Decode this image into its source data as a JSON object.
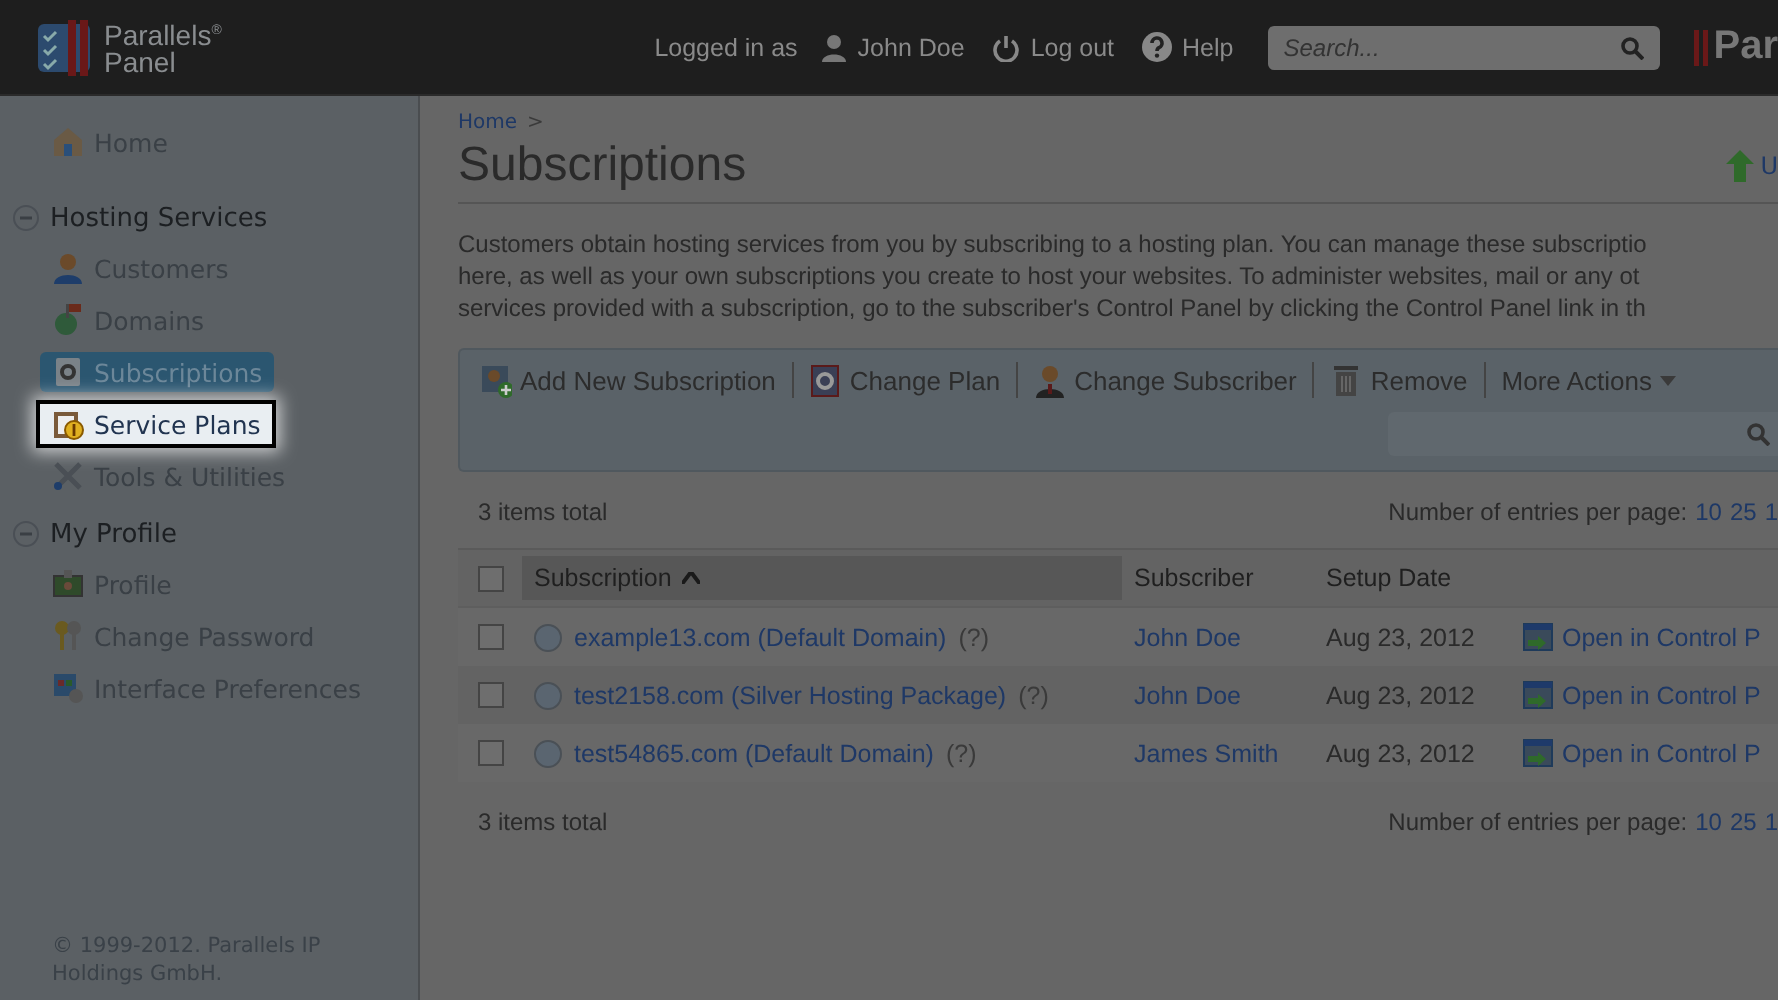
{
  "header": {
    "brand_line1": "Parallels",
    "brand_mark": "®",
    "brand_line2": "Panel",
    "logged_in_label": "Logged in as",
    "user": "John Doe",
    "logout": "Log out",
    "help": "Help",
    "search": {
      "placeholder": "Search..."
    },
    "right_logo": "Par"
  },
  "sidebar": {
    "items": [
      {
        "label": "Home",
        "selected": false,
        "highlighted": false
      }
    ],
    "sections": [
      {
        "title": "Hosting Services",
        "expanded": true,
        "children": [
          {
            "label": "Customers",
            "selected": false,
            "highlighted": false
          },
          {
            "label": "Domains",
            "selected": false,
            "highlighted": false
          },
          {
            "label": "Subscriptions",
            "selected": true,
            "highlighted": false
          },
          {
            "label": "Service Plans",
            "selected": false,
            "highlighted": true
          },
          {
            "label": "Tools & Utilities",
            "selected": false,
            "highlighted": false
          }
        ]
      },
      {
        "title": "My Profile",
        "expanded": true,
        "children": [
          {
            "label": "Profile",
            "selected": false,
            "highlighted": false
          },
          {
            "label": "Change Password",
            "selected": false,
            "highlighted": false
          },
          {
            "label": "Interface Preferences",
            "selected": false,
            "highlighted": false
          }
        ]
      }
    ],
    "copyright": "© 1999-2012. Parallels IP Holdings GmbH."
  },
  "breadcrumb": [
    {
      "label": "Home",
      "separator": ">"
    }
  ],
  "title": "Subscriptions",
  "title_action": "U",
  "description": [
    "Customers obtain hosting services from you by subscribing to a hosting plan. You can manage these subscriptio",
    "here, as well as your own subscriptions you create to host your websites. To administer websites, mail or any ot",
    "services provided with a subscription, go to the subscriber's Control Panel by clicking the Control Panel link in th"
  ],
  "toolbar": [
    {
      "label": "Add New Subscription",
      "kind": "button"
    },
    {
      "label": "Change Plan",
      "kind": "button"
    },
    {
      "label": "Change Subscriber",
      "kind": "button"
    },
    {
      "label": "Remove",
      "kind": "button"
    },
    {
      "label": "More Actions",
      "kind": "menu"
    }
  ],
  "pager_top": {
    "total": "3 items total",
    "label": "Number of entries per page:",
    "options": [
      "10",
      "25",
      "1"
    ]
  },
  "table": {
    "columns": [
      {
        "label": "Subscription",
        "sorted": true
      },
      {
        "label": "Subscriber",
        "sorted": false
      },
      {
        "label": "Setup Date",
        "sorted": false
      }
    ],
    "select_all": {
      "checked": false
    },
    "rows": [
      {
        "checked": false,
        "subscription": "example13.com (Default Domain)",
        "help": "(?)",
        "subscriber": "John Doe",
        "date": "Aug 23, 2012",
        "action": "Open in Control P"
      },
      {
        "checked": false,
        "subscription": "test2158.com (Silver Hosting Package)",
        "help": "(?)",
        "subscriber": "John Doe",
        "date": "Aug 23, 2012",
        "action": "Open in Control P"
      },
      {
        "checked": false,
        "subscription": "test54865.com (Default Domain)",
        "help": "(?)",
        "subscriber": "James Smith",
        "date": "Aug 23, 2012",
        "action": "Open in Control P"
      }
    ]
  },
  "pager_bottom": {
    "total": "3 items total",
    "label": "Number of entries per page:",
    "options": [
      "10",
      "25",
      "1"
    ]
  }
}
